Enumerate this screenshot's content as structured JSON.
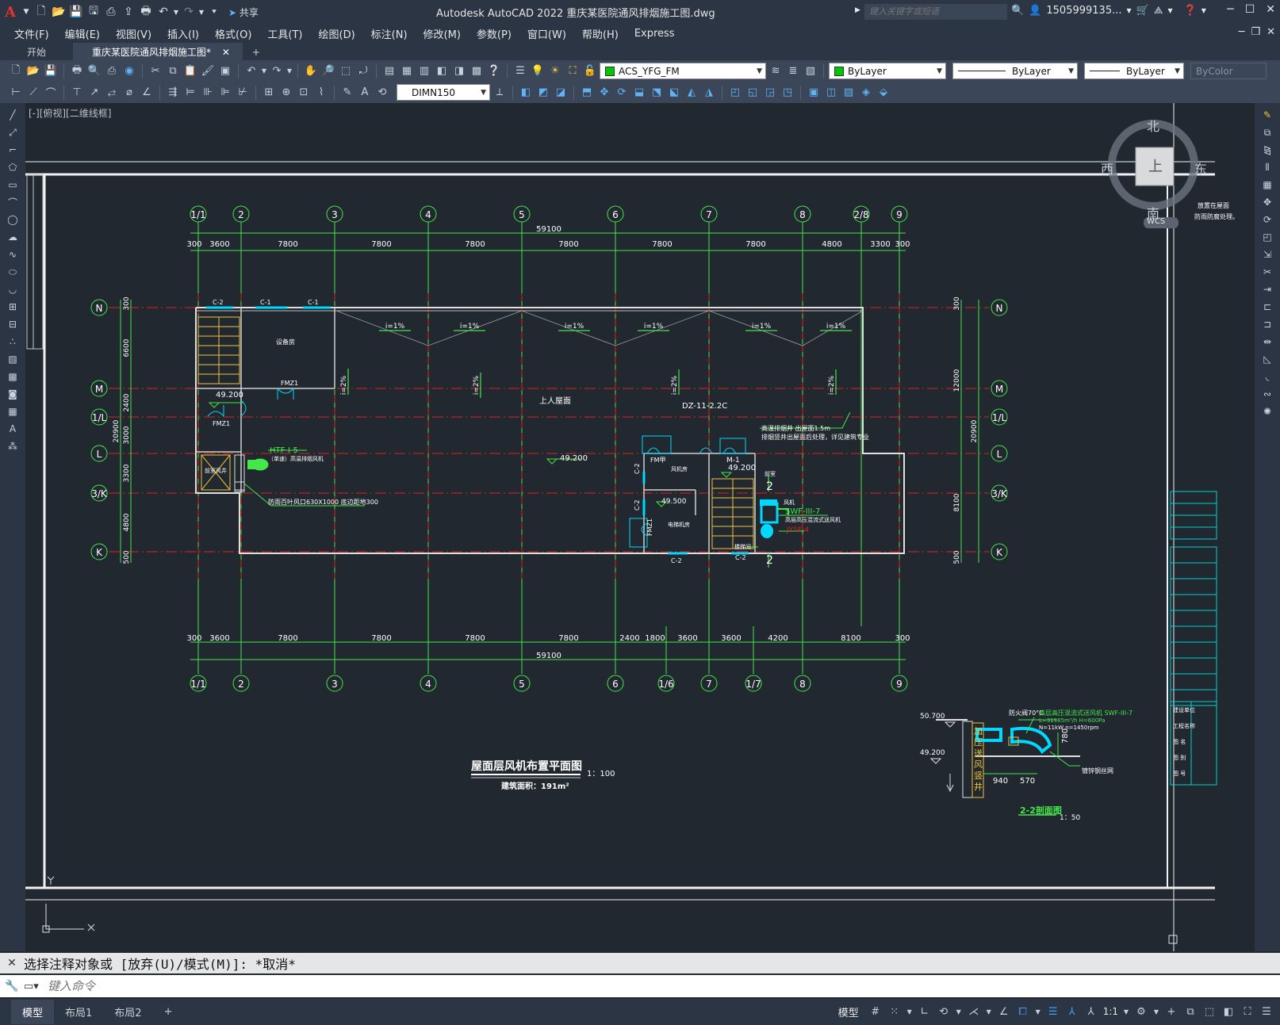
{
  "app": {
    "title": "Autodesk AutoCAD 2022    重庆某医院通风排烟施工图.dwg",
    "share_label": "共享",
    "search_placeholder": "键入关键字或短语",
    "user_name": "1505999135..."
  },
  "menu": [
    "文件(F)",
    "编辑(E)",
    "视图(V)",
    "插入(I)",
    "格式(O)",
    "工具(T)",
    "绘图(D)",
    "标注(N)",
    "修改(M)",
    "参数(P)",
    "窗口(W)",
    "帮助(H)",
    "Express"
  ],
  "tabs": {
    "start": "开始",
    "active": "重庆某医院通风排烟施工图*"
  },
  "toolbar": {
    "layer": "ACS_YFG_FM",
    "color": "ByLayer",
    "linetype": "ByLayer",
    "lineweight": "ByLayer",
    "plotstyle": "ByColor",
    "dimstyle": "DIMN150",
    "layer_color": "#00c800"
  },
  "viewport": {
    "label": "[-][俯视][二维线框]",
    "viewcube": {
      "north": "北",
      "south": "南",
      "east": "东",
      "west": "西",
      "face": "上",
      "wcs": "WCS"
    }
  },
  "drawing": {
    "axes_top": [
      "1/1",
      "2",
      "3",
      "4",
      "5",
      "6",
      "7",
      "8",
      "2/8",
      "9"
    ],
    "axes_bottom": [
      "1/1",
      "2",
      "3",
      "4",
      "5",
      "6",
      "1/6",
      "7",
      "1/7",
      "8",
      "9"
    ],
    "axes_side": [
      "N",
      "M",
      "1/L",
      "L",
      "3/K",
      "K"
    ],
    "dims_top_total": "59100",
    "dims_top": [
      "300",
      "3600",
      "7800",
      "7800",
      "7800",
      "7800",
      "7800",
      "7800",
      "4800",
      "3300",
      "300"
    ],
    "dims_bottom_total": "59100",
    "dims_bottom": [
      "300",
      "3600",
      "7800",
      "7800",
      "7800",
      "7800",
      "2400",
      "1800",
      "3600",
      "3600",
      "4200",
      "8100",
      "300"
    ],
    "dims_left": [
      "300",
      "6600",
      "2400",
      "3000",
      "3300",
      "4800",
      "500"
    ],
    "dims_left_total": "20900",
    "dims_right": [
      "300",
      "12000",
      "8100",
      "500"
    ],
    "dims_right_total": "20900",
    "slopes": [
      "i=1%",
      "i=1%",
      "i=1%",
      "i=1%",
      "i=1%",
      "i=1%"
    ],
    "slopes_v": [
      "i=2%",
      "i=2%",
      "i=2%",
      "i=2%"
    ],
    "labels": {
      "roof": "上人屋面",
      "equip_room": "设备房",
      "elev_main": "49.200",
      "elev_stair": "49.200",
      "elev_stair2": "49.200",
      "elev_machine": "49.500",
      "dz": "DZ-11-2.2C",
      "htf": "HTF-I-5",
      "htf_desc": "（单速）高温排烟风机",
      "swf": "SWF-III-7",
      "swf_desc": "高层高压混流式送风机",
      "ysf": "JYSF-4",
      "louver": "防雨百叶风口630X1000  底边距地300",
      "note1": "高温排烟井  出屋面1.5m",
      "note2": "排烟竖井出屋面后处理，详见建筑专业",
      "fmz1": "FMZ1",
      "fmz2": "FMZ1",
      "fmz3": "FMZ1",
      "fmjia": "FM甲",
      "m1": "M-1",
      "c1a": "C-1",
      "c1b": "C-1",
      "c2a": "C-2",
      "c2b": "C-2",
      "c2c": "C-2",
      "c2d": "C-2",
      "c2e": "C-2",
      "stair_room": "前室",
      "fan_room": "风机房",
      "elec_room": "电梯机房",
      "wind_room": "楼梯间",
      "section_mark": "2",
      "section_mark2": "2",
      "left_shaft": "前室风井",
      "fan_in": "风机"
    },
    "plan_title": "屋面层风机布置平面图",
    "plan_scale": "1：100",
    "plan_area": "建筑面积：191m²",
    "section": {
      "title": "2-2剖面图",
      "scale": "1：50",
      "elev_top": "50.700",
      "elev_bottom": "49.200",
      "damper": "防火阀70°C",
      "fan_spec1": "高层高压混流式送风机 SWF-III-7",
      "fan_spec2": "L=31985m³/h  H=600Pa",
      "fan_spec3": "N=11kW  n=1450rpm",
      "dim1": "940",
      "dim2": "570",
      "dim3": "780",
      "base": "镀锌钢丝网",
      "shaft": "加压送风竖井"
    },
    "titleblock": [
      "建设单位",
      "工程名称",
      "图  名",
      "图  别",
      "图  号"
    ],
    "right_note1": "放置在屋面",
    "right_note2": "防雨防腐处理。"
  },
  "command": {
    "history": "选择注释对象或 [放弃(U)/模式(M)]: *取消*",
    "placeholder": "键入命令"
  },
  "status": {
    "layouts": [
      "模型",
      "布局1",
      "布局2"
    ],
    "model": "模型",
    "scale": "1:1"
  }
}
